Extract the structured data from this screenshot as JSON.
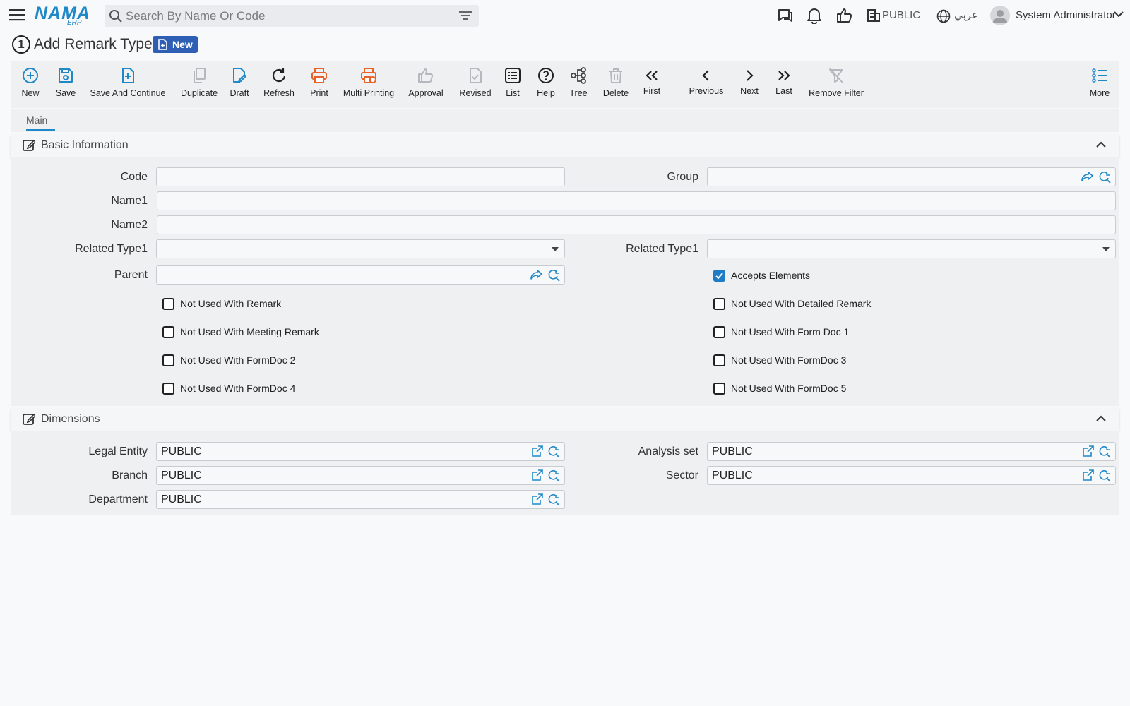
{
  "topbar": {
    "logo_text": "NAMA",
    "logo_sub": "ERP",
    "search_placeholder": "Search By Name Or Code",
    "legal_entity": "PUBLIC",
    "language": "عربي",
    "user": "System Administrator"
  },
  "page": {
    "step": "1",
    "title": "Add Remark Type",
    "badge": "New"
  },
  "toolbar": {
    "new": "New",
    "save": "Save",
    "save_continue": "Save And Continue",
    "duplicate": "Duplicate",
    "draft": "Draft",
    "refresh": "Refresh",
    "print": "Print",
    "multi_printing": "Multi Printing",
    "approval": "Approval",
    "revised": "Revised",
    "list": "List",
    "help": "Help",
    "tree": "Tree",
    "delete": "Delete",
    "first": "First",
    "previous": "Previous",
    "next": "Next",
    "last": "Last",
    "remove_filter": "Remove Filter",
    "more": "More"
  },
  "tabs": {
    "main": "Main"
  },
  "basic": {
    "title": "Basic Information",
    "code_label": "Code",
    "code_value": "",
    "group_label": "Group",
    "group_value": "",
    "name1_label": "Name1",
    "name1_value": "",
    "name2_label": "Name2",
    "name2_value": "",
    "related1_label": "Related Type1",
    "related1_value": "",
    "related2_label": "Related Type1",
    "related2_value": "",
    "parent_label": "Parent",
    "parent_value": "",
    "accepts_elements": "Accepts Elements",
    "checkboxes": {
      "remark": "Not Used With Remark",
      "detailed_remark": "Not Used With Detailed Remark",
      "meeting_remark": "Not Used With Meeting Remark",
      "form_doc_1": "Not Used With Form Doc 1",
      "formdoc_2": "Not Used With FormDoc 2",
      "formdoc_3": "Not Used With FormDoc 3",
      "formdoc_4": "Not Used With FormDoc 4",
      "formdoc_5": "Not Used With FormDoc 5"
    }
  },
  "dimensions": {
    "title": "Dimensions",
    "legal_entity_label": "Legal Entity",
    "legal_entity_value": "PUBLIC",
    "analysis_set_label": "Analysis set",
    "analysis_set_value": "PUBLIC",
    "branch_label": "Branch",
    "branch_value": "PUBLIC",
    "sector_label": "Sector",
    "sector_value": "PUBLIC",
    "department_label": "Department",
    "department_value": "PUBLIC"
  },
  "colors": {
    "accent": "#1e88c8",
    "badge": "#2f5fb5",
    "print": "#e8622a",
    "disabled": "#b5b9bd"
  }
}
